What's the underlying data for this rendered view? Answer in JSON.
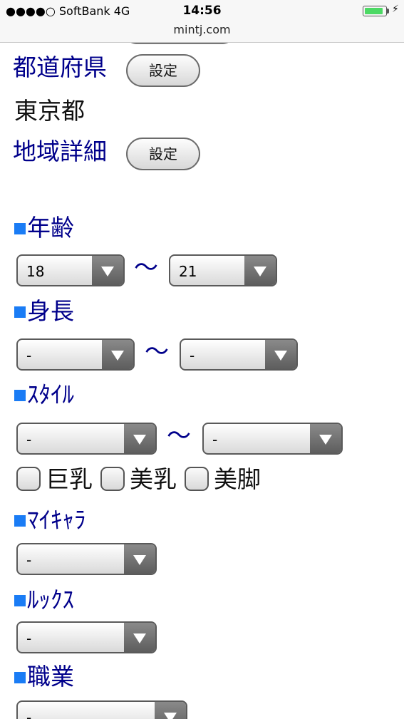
{
  "status": {
    "carrier": "●●●●○ SoftBank   4G",
    "time": "14:56",
    "url": "mintj.com",
    "battery_level": 0.9,
    "battery_color": "#4cd964"
  },
  "area": {
    "prefecture_label": "都道府県",
    "set_label": "設定",
    "prefecture_value": "東京都",
    "region_label": "地域詳細"
  },
  "section_marker_color": "#1a7cf5",
  "link_color": "#00008b",
  "sections": {
    "age": {
      "title": "年齢",
      "from": "18",
      "to": "21"
    },
    "height": {
      "title": "身長",
      "from": "-",
      "to": "-"
    },
    "style": {
      "title": "ｽﾀｲﾙ",
      "from": "-",
      "to": "-",
      "options": [
        "巨乳",
        "美乳",
        "美脚"
      ]
    },
    "mychara": {
      "title": "ﾏｲｷｬﾗ",
      "value": "-"
    },
    "looks": {
      "title": "ﾙｯｸｽ",
      "value": "-"
    },
    "job": {
      "title": "職業",
      "value": "-"
    }
  },
  "separator": "〜"
}
